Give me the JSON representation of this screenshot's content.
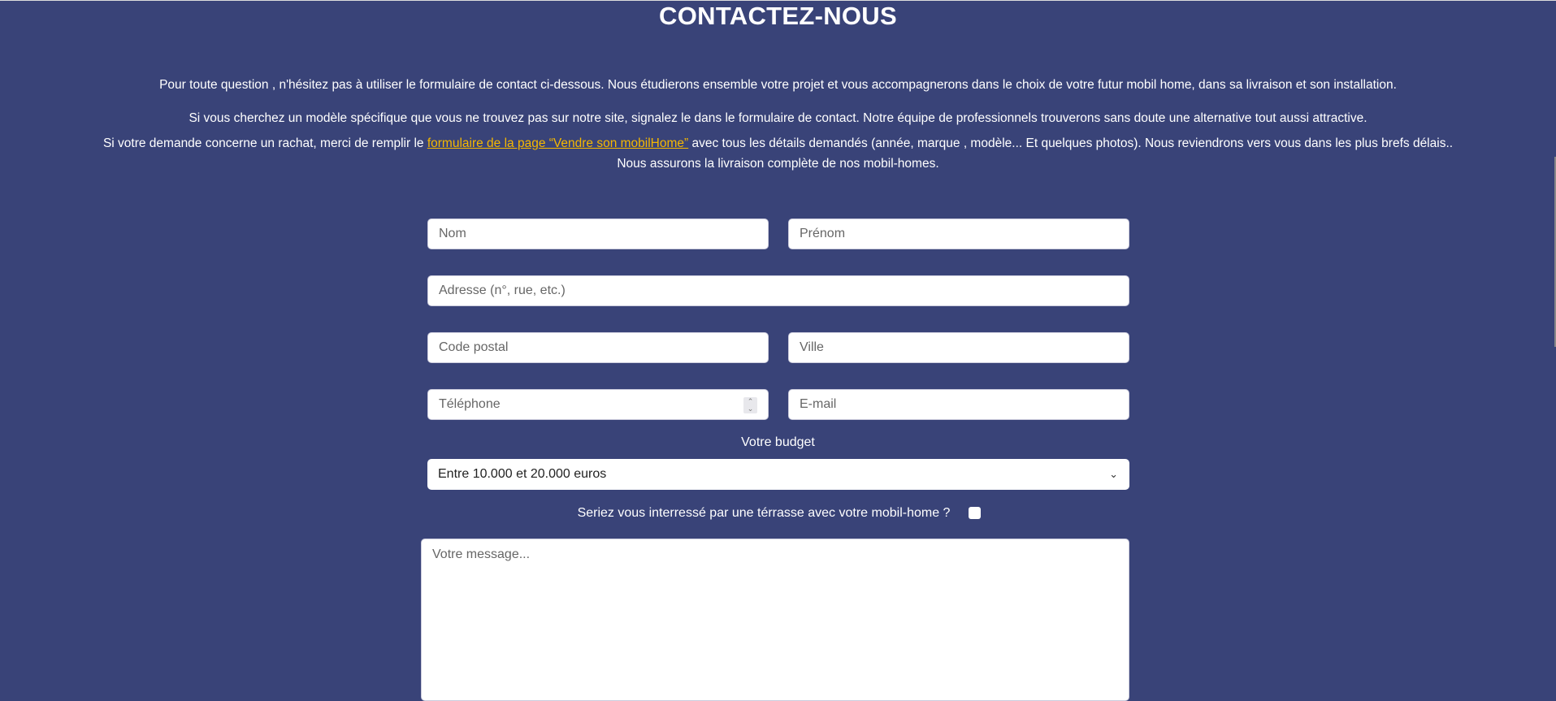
{
  "title": "CONTACTEZ-NOUS",
  "intro": {
    "p1": "Pour toute question , n'hésitez pas à utiliser le formulaire de contact ci-dessous. Nous étudierons ensemble votre projet et vous accompagnerons dans le choix de votre futur mobil home, dans sa livraison et son installation.",
    "p2": "Si vous cherchez un modèle spécifique que vous ne trouvez pas sur notre site, signalez le dans le formulaire de contact. Notre équipe de professionnels trouverons sans doute une alternative tout aussi attractive.",
    "p3_before": "Si votre demande concerne un rachat, merci de remplir le ",
    "p3_link": "formulaire de la page “Vendre son mobilHome”",
    "p3_after": " avec tous les détails demandés (année, marque , modèle... Et quelques photos). Nous reviendrons vers vous dans les plus brefs délais..",
    "p4": "Nous assurons la livraison complète de nos mobil-homes."
  },
  "form": {
    "nom": "Nom",
    "prenom": "Prénom",
    "adresse": "Adresse (n°, rue, etc.)",
    "code_postal": "Code postal",
    "ville": "Ville",
    "telephone": "Téléphone",
    "email": "E-mail",
    "budget_label": "Votre budget",
    "budget_value": "Entre 10.000 et 20.000 euros",
    "terrasse_label": "Seriez vous interressé par une térrasse avec votre mobil-home ?",
    "message": "Votre message..."
  },
  "colors": {
    "background": "#394378",
    "link": "#f5b800"
  }
}
